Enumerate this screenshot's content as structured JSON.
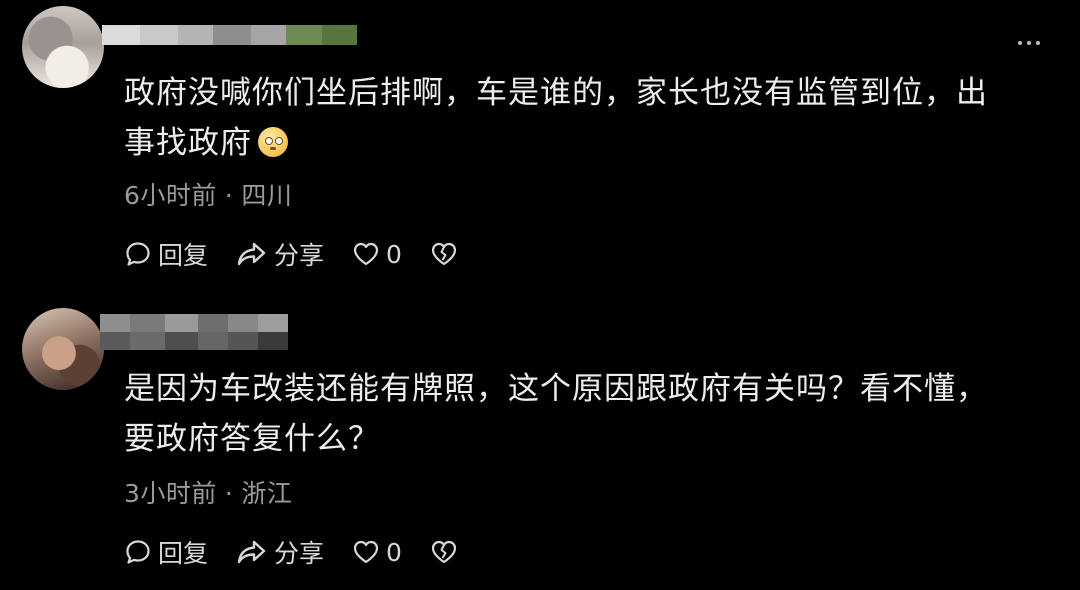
{
  "comments": [
    {
      "content_line1": "政府没喊你们坐后排啊，车是谁的，家长也没有监管到位，出",
      "content_line2": "事找政府",
      "emoji_icon": "grinning-awkward-emoji",
      "time": "6小时前",
      "separator": "·",
      "location": "四川",
      "actions": {
        "reply_label": "回复",
        "share_label": "分享",
        "like_count": "0"
      }
    },
    {
      "content_line1": "是因为车改装还能有牌照，这个原因跟政府有关吗？看不懂，",
      "content_line2": "要政府答复什么？",
      "time": "3小时前",
      "separator": "·",
      "location": "浙江",
      "actions": {
        "reply_label": "回复",
        "share_label": "分享",
        "like_count": "0"
      }
    }
  ],
  "icons": {
    "more": "more-dots-icon",
    "reply": "comment-bubble-icon",
    "share": "share-arrow-icon",
    "like": "heart-icon",
    "dislike": "broken-heart-icon"
  },
  "colors": {
    "background": "#000000",
    "text": "#ededed",
    "meta": "#9a9a9a"
  }
}
